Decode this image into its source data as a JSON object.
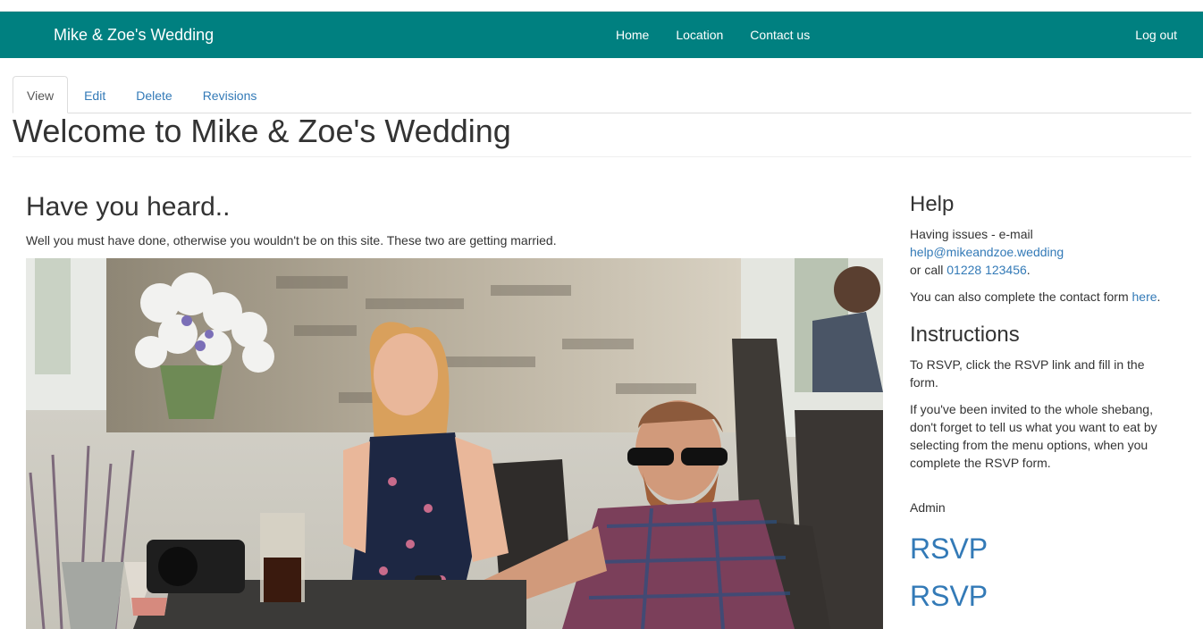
{
  "navbar": {
    "brand": "Mike & Zoe's Wedding",
    "links": [
      "Home",
      "Location",
      "Contact us"
    ],
    "logout": "Log out"
  },
  "tabs": [
    {
      "label": "View",
      "active": true
    },
    {
      "label": "Edit",
      "active": false
    },
    {
      "label": "Delete",
      "active": false
    },
    {
      "label": "Revisions",
      "active": false
    }
  ],
  "page": {
    "title": "Welcome to Mike & Zoe's Wedding"
  },
  "main": {
    "heading": "Have you heard..",
    "intro": "Well you must have done, otherwise you wouldn't be on this site. These two are getting married."
  },
  "sidebar": {
    "help": {
      "heading": "Help",
      "line1": "Having issues - e-mail",
      "email": "help@mikeandzoe.wedding",
      "call_prefix": "or call",
      "phone": "01228 123456",
      "call_suffix": ".",
      "contact_text": "You can also complete the contact form",
      "contact_link": "here",
      "contact_suffix": "."
    },
    "instructions": {
      "heading": "Instructions",
      "p1": "To RSVP, click the RSVP link and fill in the form.",
      "p2": "If you've been invited to the whole shebang, don't forget to tell us what you want to eat by selecting from the menu options, when you complete the RSVP form."
    },
    "admin_label": "Admin",
    "rsvp_links": [
      "RSVP",
      "RSVP"
    ]
  },
  "colors": {
    "navbar_bg": "#008080",
    "link": "#337ab7",
    "text": "#333333"
  }
}
